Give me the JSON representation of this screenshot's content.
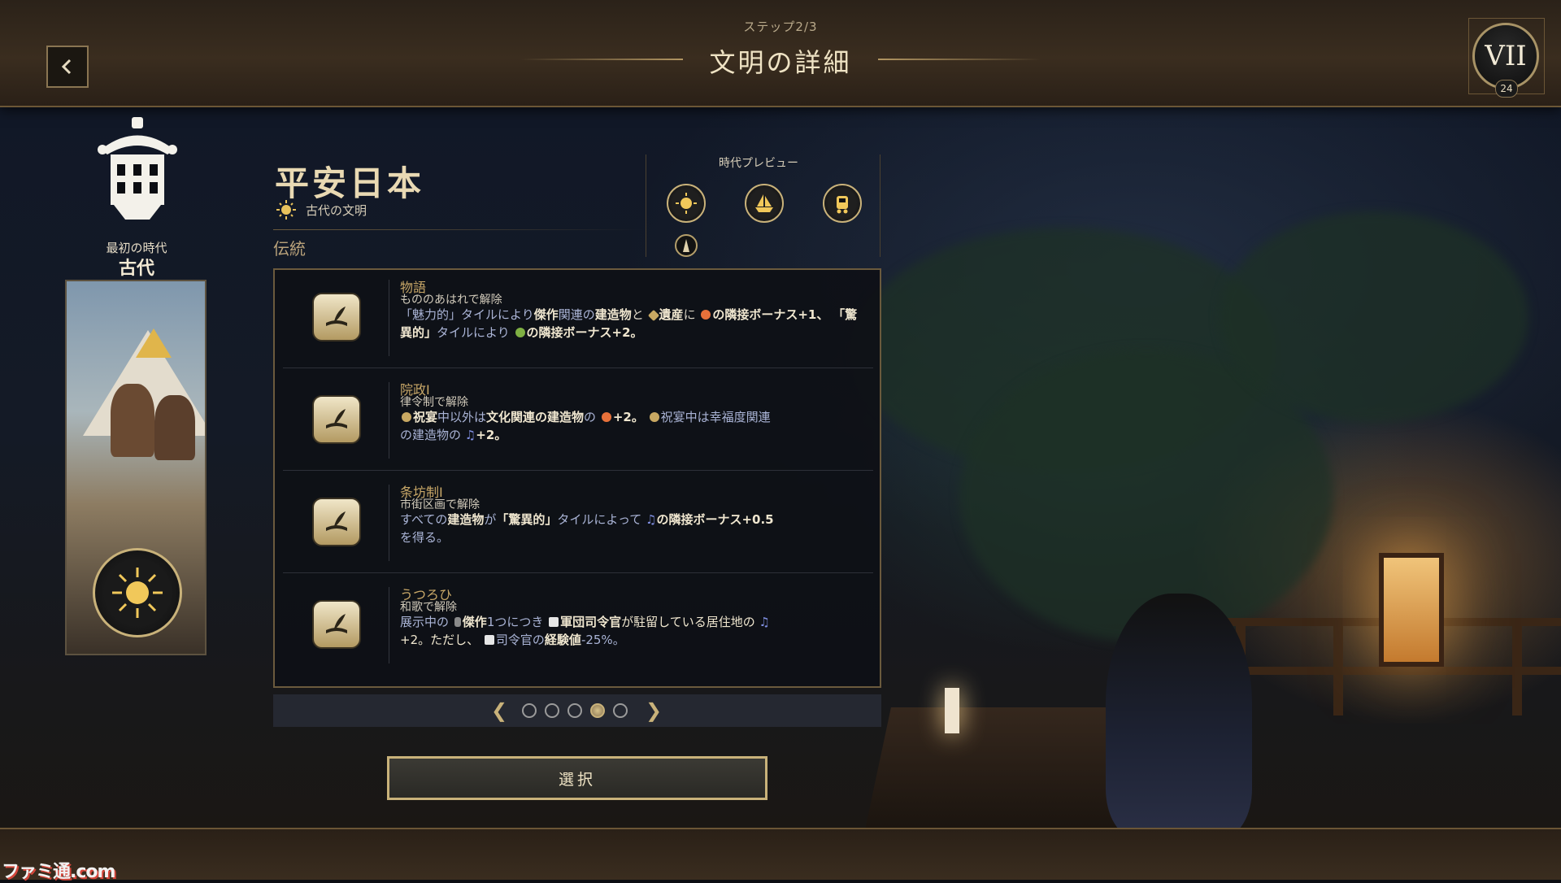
{
  "header": {
    "step": "ステップ2/3",
    "title": "文明の詳細",
    "era_badge": "VII",
    "era_count": "24"
  },
  "left": {
    "era_label": "最初の時代",
    "era_name": "古代"
  },
  "civ": {
    "name": "平安日本",
    "subtitle": "古代の文明",
    "tradition_label": "伝統"
  },
  "preview": {
    "label": "時代プレビュー",
    "icons": [
      "sun-icon",
      "ship-icon",
      "train-icon"
    ],
    "small_icon": "monument-icon"
  },
  "traditions": [
    {
      "title": "物語",
      "unlock": "もののあはれで解除",
      "desc_parts": [
        "「魅力的」タイルにより",
        "傑作",
        "関連の",
        "建造物",
        "と",
        "遺産",
        "に",
        "の隣接ボーナス+1、",
        "「驚異的」",
        "タイルにより",
        "の隣接ボーナス+2。"
      ]
    },
    {
      "title": "院政I",
      "unlock": "律令制で解除",
      "desc_parts": [
        "祝宴",
        "中以外は",
        "文化関連の建造物",
        "の",
        "+2。",
        "祝宴中は幸福度関連",
        "の建造物の",
        "+2。"
      ]
    },
    {
      "title": "条坊制I",
      "unlock": "市街区画で解除",
      "desc_parts": [
        "すべての",
        "建造物",
        "が",
        "「驚異的」",
        "タイルによって",
        "の隣接ボーナス+0.5",
        "を得る。"
      ]
    },
    {
      "title": "うつろひ",
      "unlock": "和歌で解除",
      "desc_parts": [
        "展示中の",
        "傑作",
        "1つにつき",
        "軍団司令官",
        "が駐留している居住地の",
        "+2。ただし、",
        "司令官の",
        "経験値",
        "-25%。"
      ]
    }
  ],
  "pager": {
    "total": 5,
    "active": 4
  },
  "select_label": "選択",
  "watermark": "ファミ通.com",
  "colors": {
    "accent_gold": "#c9b27a",
    "title_gold": "#e9d9b3",
    "label_gold": "#c9a868",
    "panel_bg": "#0e1016",
    "highlight_blue": "#aab4d6"
  }
}
